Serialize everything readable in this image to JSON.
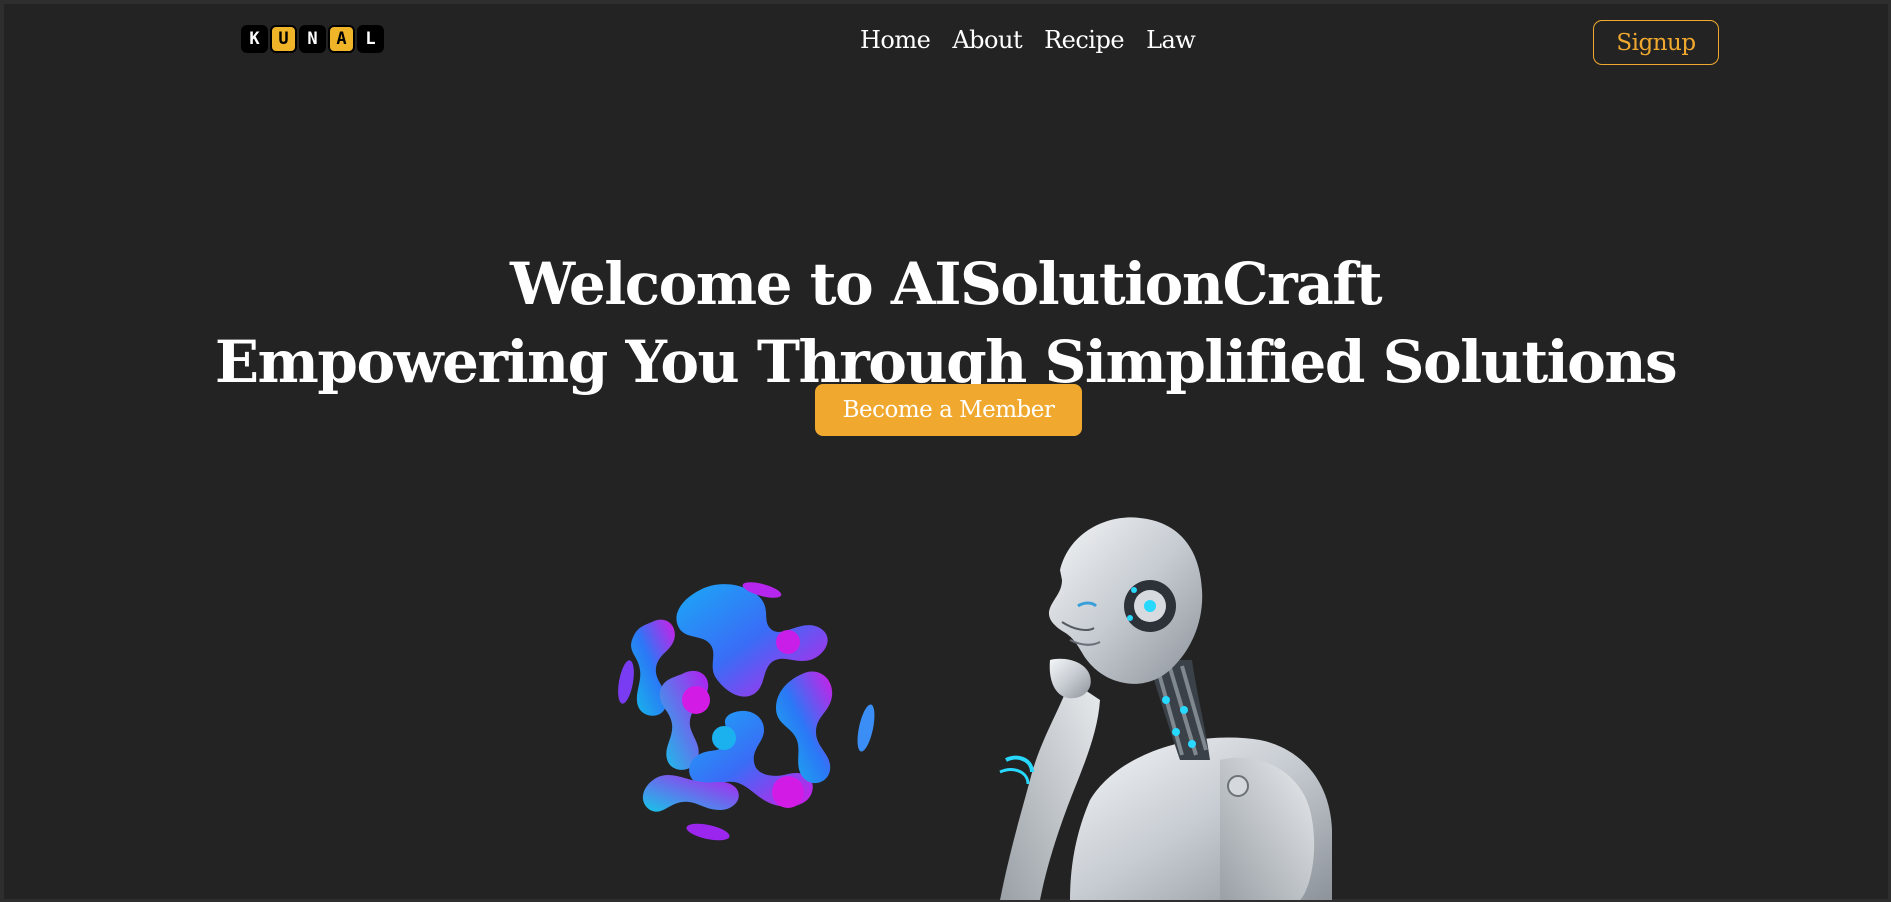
{
  "logo": {
    "letters": [
      "K",
      "U",
      "N",
      "A",
      "L"
    ]
  },
  "nav": {
    "items": [
      "Home",
      "About",
      "Recipe",
      "Law"
    ]
  },
  "signup_label": "Signup",
  "hero": {
    "line1": "Welcome to AISolutionCraft",
    "line2": "Empowering You Through Simplified Solutions",
    "cta_label": "Become a Member"
  },
  "colors": {
    "background": "#232323",
    "accent": "#f0a92e",
    "text": "#ffffff"
  },
  "icons": {
    "blob": "abstract-sphere-graphic",
    "robot": "ai-robot-illustration"
  }
}
